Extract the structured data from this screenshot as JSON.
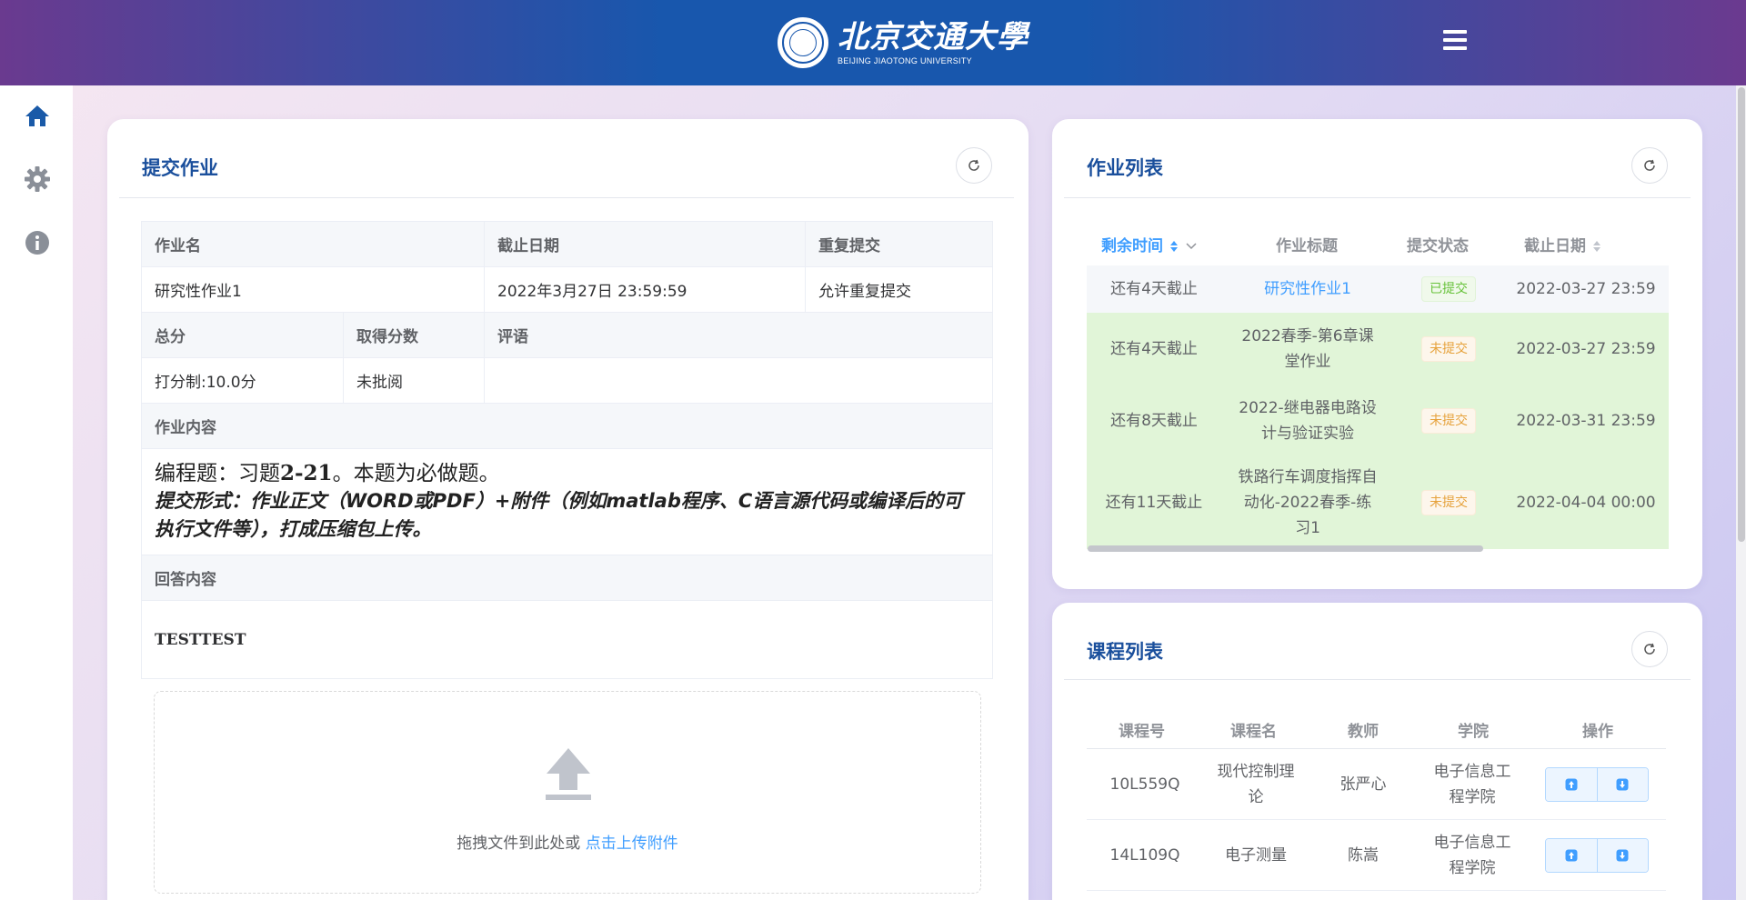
{
  "header": {
    "logo_cn": "北京交通大學",
    "logo_en": "BEIJING JIAOTONG UNIVERSITY"
  },
  "sidebar": {
    "items": [
      {
        "icon": "home-icon"
      },
      {
        "icon": "gear-icon"
      },
      {
        "icon": "info-icon"
      }
    ]
  },
  "submit": {
    "title": "提交作业",
    "labels": {
      "name": "作业名",
      "deadline": "截止日期",
      "resubmit": "重复提交",
      "total": "总分",
      "score": "取得分数",
      "comment": "评语",
      "content": "作业内容",
      "answer": "回答内容"
    },
    "values": {
      "name": "研究性作业1",
      "deadline": "2022年3月27日 23:59:59",
      "resubmit": "允许重复提交",
      "total": "打分制:10.0分",
      "score": "未批阅",
      "comment": ""
    },
    "content_main_pre": "编程题：习题",
    "content_main_num": "2-21",
    "content_main_post": "。本题为必做题。",
    "content_sub": "提交形式：作业正文（WORD或PDF）+附件（例如matlab程序、C语言源代码或编译后的可执行文件等），打成压缩包上传。",
    "answer": "TESTTEST",
    "upload_text": "拖拽文件到此处或 ",
    "upload_link": "点击上传附件"
  },
  "homework": {
    "title": "作业列表",
    "columns": [
      "剩余时间",
      "作业标题",
      "提交状态",
      "截止日期"
    ],
    "rows": [
      {
        "remain": "还有4天截止",
        "title": "研究性作业1",
        "status": "已提交",
        "deadline": "2022-03-27 23:59",
        "submitted": true
      },
      {
        "remain": "还有4天截止",
        "title": "2022春季-第6章课堂作业",
        "status": "未提交",
        "deadline": "2022-03-27 23:59",
        "submitted": false
      },
      {
        "remain": "还有8天截止",
        "title": "2022-继电器电路设计与验证实验",
        "status": "未提交",
        "deadline": "2022-03-31 23:59",
        "submitted": false
      },
      {
        "remain": "还有11天截止",
        "title": "铁路行车调度指挥自动化-2022春季-练习1",
        "status": "未提交",
        "deadline": "2022-04-04 00:00",
        "submitted": false
      }
    ],
    "colors": {
      "selected": "#f5f7fa",
      "pending": "#e1f5d8",
      "link": "#409eff"
    }
  },
  "courses": {
    "title": "课程列表",
    "columns": [
      "课程号",
      "课程名",
      "教师",
      "学院",
      "操作"
    ],
    "rows": [
      {
        "code": "10L559Q",
        "name": "现代控制理论",
        "teacher": "张严心",
        "college": "电子信息工程学院"
      },
      {
        "code": "14L109Q",
        "name": "电子测量",
        "teacher": "陈嵩",
        "college": "电子信息工程学院"
      }
    ]
  },
  "theme": {
    "accent": "#1a4f9c",
    "brand_blue": "#1857ad",
    "brand_purple": "#6a3a8f"
  }
}
